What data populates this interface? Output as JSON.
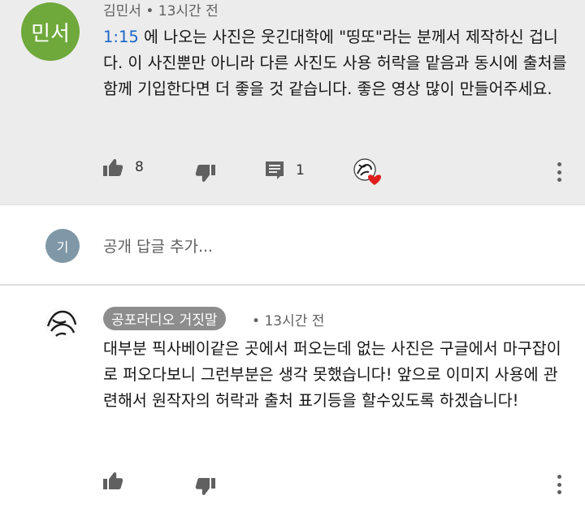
{
  "comment_top": {
    "avatar_text": "민서",
    "author": "김민서",
    "time": "13시간 전",
    "timestamp_link": "1:15",
    "text": " 에 나오는 사진은 웃긴대학에 \"띵또\"라는 분께서 제작하신 겁니다. 이 사진뿐만 아니라 다른 사진도 사용 허락을 맡음과 동시에 출처를 함께 기입한다면 더 좋을 것 같습니다. 좋은 영상 많이 만들어주세요.",
    "like_count": "8",
    "reply_count": "1",
    "icons": {
      "like": "thumbs-up-icon",
      "dislike": "thumbs-down-icon",
      "reply": "comment-icon",
      "heart": "creator-heart-icon",
      "more": "more-vert-icon"
    }
  },
  "reply_box": {
    "avatar_text": "기",
    "placeholder": "공개 답글 추가..."
  },
  "comment_second": {
    "author": "공포라디오 거짓말",
    "time": "13시간 전",
    "text": "대부분 픽사베이같은 곳에서 퍼오는데 없는 사진은 구글에서 마구잡이로 퍼오다보니 그런부분은 생각 못했습니다! 앞으로 이미지 사용에 관련해서 원작자의 허락과 출처 표기등을 할수있도록 하겠습니다!",
    "icons": {
      "like": "thumbs-up-icon",
      "dislike": "thumbs-down-icon",
      "more": "more-vert-icon"
    }
  },
  "colors": {
    "highlight_bg": "#ececec",
    "link": "#1a65c8",
    "avatar_green": "#6fa83b",
    "avatar_gray": "#7f97a6",
    "badge_bg": "#8d8d8d",
    "heart": "#e01e1e",
    "icon": "#606060"
  }
}
